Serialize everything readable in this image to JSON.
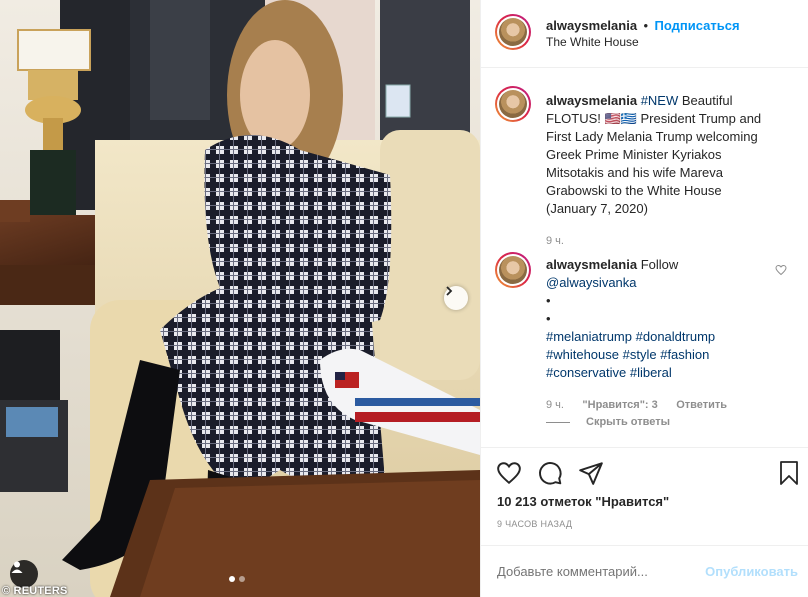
{
  "photo": {
    "credit": "© REUTERS",
    "carousel": {
      "count": 2,
      "current": 1
    }
  },
  "header": {
    "username": "alwaysmelania",
    "separator": "•",
    "follow_label": "Подписаться",
    "location": "The White House"
  },
  "caption": {
    "username": "alwaysmelania",
    "text_lines": [
      {
        "parts": [
          {
            "text": "#NEW",
            "link": true
          },
          {
            "text": " Beautiful",
            "link": false
          }
        ]
      },
      {
        "parts": [
          {
            "text": "FLOTUS! 🇺🇸🇬🇷 President Trump and",
            "link": false
          }
        ]
      },
      {
        "parts": [
          {
            "text": "First Lady Melania Trump welcoming",
            "link": false
          }
        ]
      },
      {
        "parts": [
          {
            "text": "Greek Prime Minister Kyriakos",
            "link": false
          }
        ]
      },
      {
        "parts": [
          {
            "text": "Mitsotakis and his wife Mareva",
            "link": false
          }
        ]
      },
      {
        "parts": [
          {
            "text": "Grabowski to the White House",
            "link": false
          }
        ]
      },
      {
        "parts": [
          {
            "text": "(January 7, 2020)",
            "link": false
          }
        ]
      }
    ],
    "time": "9 ч."
  },
  "comment": {
    "username": "alwaysmelania",
    "text_lines": [
      {
        "parts": [
          {
            "text": " Follow",
            "link": false
          }
        ]
      },
      {
        "parts": [
          {
            "text": "@alwaysivanka",
            "link": true
          }
        ]
      },
      {
        "parts": [
          {
            "text": "•",
            "link": false
          }
        ]
      },
      {
        "parts": [
          {
            "text": "•",
            "link": false
          }
        ]
      },
      {
        "parts": [
          {
            "text": "#melaniatrump",
            "link": true
          },
          {
            "text": " ",
            "link": false
          },
          {
            "text": "#donaldtrump",
            "link": true
          }
        ]
      },
      {
        "parts": [
          {
            "text": "#whitehouse",
            "link": true
          },
          {
            "text": " ",
            "link": false
          },
          {
            "text": "#style",
            "link": true
          },
          {
            "text": " ",
            "link": false
          },
          {
            "text": "#fashion",
            "link": true
          }
        ]
      },
      {
        "parts": [
          {
            "text": "#conservative",
            "link": true
          },
          {
            "text": " ",
            "link": false
          },
          {
            "text": "#liberal",
            "link": true
          }
        ]
      }
    ],
    "time": "9 ч.",
    "likes_label": "\"Нравится\": 3",
    "reply_label": "Ответить",
    "hide_replies_label": "Скрыть ответы"
  },
  "actions": {
    "like_icon": "heart-icon",
    "comment_icon": "comment-icon",
    "share_icon": "paper-plane-icon",
    "save_icon": "bookmark-icon"
  },
  "likes": {
    "text": "10 213 отметок \"Нравится\""
  },
  "timestamp": "9 ЧАСОВ НАЗАД",
  "add_comment": {
    "placeholder": "Добавьте комментарий...",
    "publish_label": "Опубликовать"
  },
  "colors": {
    "link": "#00376b",
    "follow": "#0095f6",
    "publish_disabled": "#b2dffc",
    "muted": "#8e8e8e"
  }
}
